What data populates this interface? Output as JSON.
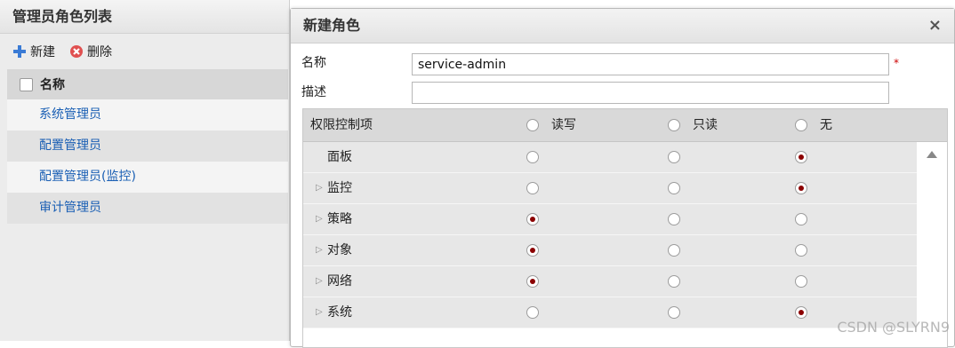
{
  "left_panel": {
    "title": "管理员角色列表",
    "toolbar": {
      "new_label": "新建",
      "delete_label": "删除"
    },
    "grid_header": "名称",
    "roles": [
      "系统管理员",
      "配置管理员",
      "配置管理员(监控)",
      "审计管理员"
    ]
  },
  "dialog": {
    "title": "新建角色",
    "close_glyph": "×",
    "name_label": "名称",
    "name_value": "service-admin",
    "required_mark": "*",
    "desc_label": "描述",
    "desc_value": "",
    "perm_header": {
      "item": "权限控制项",
      "rw": "读写",
      "ro": "只读",
      "none": "无"
    },
    "perm_rows": [
      {
        "label": "面板",
        "expandable": false,
        "selected": "none"
      },
      {
        "label": "监控",
        "expandable": true,
        "selected": "none"
      },
      {
        "label": "策略",
        "expandable": true,
        "selected": "rw"
      },
      {
        "label": "对象",
        "expandable": true,
        "selected": "rw"
      },
      {
        "label": "网络",
        "expandable": true,
        "selected": "rw"
      },
      {
        "label": "系统",
        "expandable": true,
        "selected": "none"
      }
    ]
  },
  "watermark": "CSDN @SLYRN9",
  "colors": {
    "link": "#1a5fb4",
    "radio_dot": "#8b0000",
    "required": "#cc0000"
  }
}
